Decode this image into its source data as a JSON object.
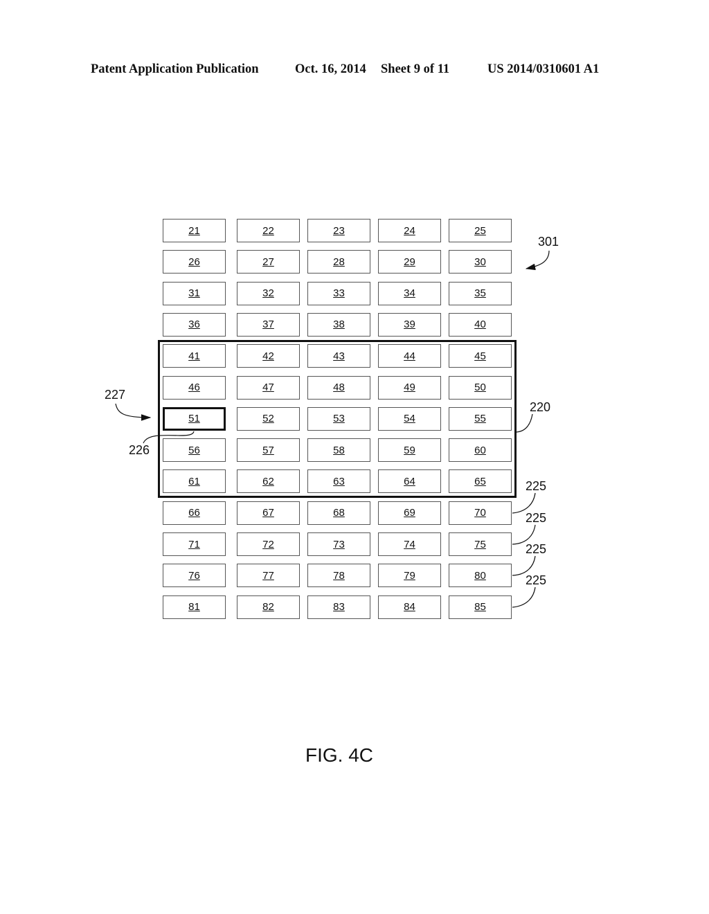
{
  "header": {
    "publication": "Patent Application Publication",
    "date": "Oct. 16, 2014",
    "sheet": "Sheet 9 of 11",
    "number": "US 2014/0310601 A1"
  },
  "grid": {
    "columns": 5,
    "cells": [
      "21",
      "22",
      "23",
      "24",
      "25",
      "26",
      "27",
      "28",
      "29",
      "30",
      "31",
      "32",
      "33",
      "34",
      "35",
      "36",
      "37",
      "38",
      "39",
      "40",
      "41",
      "42",
      "43",
      "44",
      "45",
      "46",
      "47",
      "48",
      "49",
      "50",
      "51",
      "52",
      "53",
      "54",
      "55",
      "56",
      "57",
      "58",
      "59",
      "60",
      "61",
      "62",
      "63",
      "64",
      "65",
      "66",
      "67",
      "68",
      "69",
      "70",
      "71",
      "72",
      "73",
      "74",
      "75",
      "76",
      "77",
      "78",
      "79",
      "80",
      "81",
      "82",
      "83",
      "84",
      "85"
    ],
    "selected": "51",
    "group_220_rows": [
      4,
      8
    ]
  },
  "labels": {
    "ref_301": "301",
    "ref_220": "220",
    "ref_227": "227",
    "ref_226": "226",
    "ref_225": [
      "225",
      "225",
      "225",
      "225"
    ]
  },
  "caption": "FIG. 4C"
}
